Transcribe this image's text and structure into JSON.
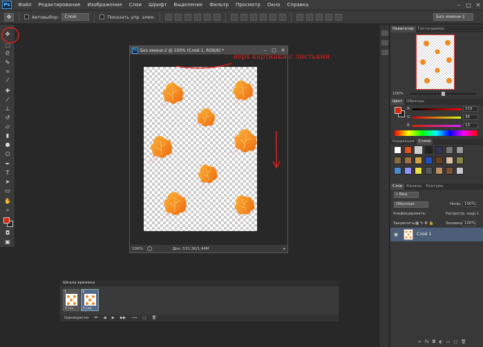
{
  "app": {
    "logo": "Ps",
    "menu": [
      "Файл",
      "Редактирование",
      "Изображение",
      "Слои",
      "Шрифт",
      "Выделение",
      "Фильтр",
      "Просмотр",
      "Окно",
      "Справка"
    ],
    "window_buttons": [
      "–",
      "□",
      "✕"
    ]
  },
  "options_bar": {
    "tool_icon": "move-tool-icon",
    "autoselect_label": "Автовыбор:",
    "autoselect_value": "Слой",
    "show_controls_label": "Показать упр. элем.",
    "workspace_value": "Без имени-1"
  },
  "document": {
    "title": "Без имени-2 @ 100% (Слой 1, RGB/8) *",
    "zoom": "100%",
    "doc_size": "Док: 531,3K/1,44M",
    "window_buttons": [
      "–",
      "□",
      "✕"
    ]
  },
  "annotation": {
    "text": "верх картинки с листьями",
    "color": "#d42020"
  },
  "navigator": {
    "tabs": [
      "Навигатор",
      "Гистограмма"
    ],
    "zoom": "100%"
  },
  "color_panel": {
    "tabs": [
      "Цвет",
      "Образцы"
    ],
    "channels": [
      {
        "label": "R",
        "value": "219"
      },
      {
        "label": "G",
        "value": "36"
      },
      {
        "label": "B",
        "value": "13"
      }
    ],
    "foreground": "#db240d"
  },
  "styles_panel": {
    "tabs": [
      "Коррекция",
      "Стили"
    ]
  },
  "layers_panel": {
    "tabs": [
      "Слои",
      "Каналы",
      "Контуры"
    ],
    "kind_label": "Вид",
    "blend_mode": "Обычные",
    "opacity_label": "Непр:",
    "opacity_value": "100%",
    "unify_label": "Унифицировать:",
    "propagate_label": "Распростр. кадр 1",
    "lock_label": "Закрепить:",
    "fill_label": "Заливка:",
    "fill_value": "100%",
    "layer_name": "Слой 1"
  },
  "timeline": {
    "title": "Шкала времени",
    "frames": [
      {
        "number": "1",
        "delay": "0 сек."
      },
      {
        "number": "2",
        "delay": "0 сек."
      }
    ],
    "loop": "Однократно"
  },
  "colors": {
    "accent": "#3d7ab8",
    "leaf": "#f08a1c"
  }
}
